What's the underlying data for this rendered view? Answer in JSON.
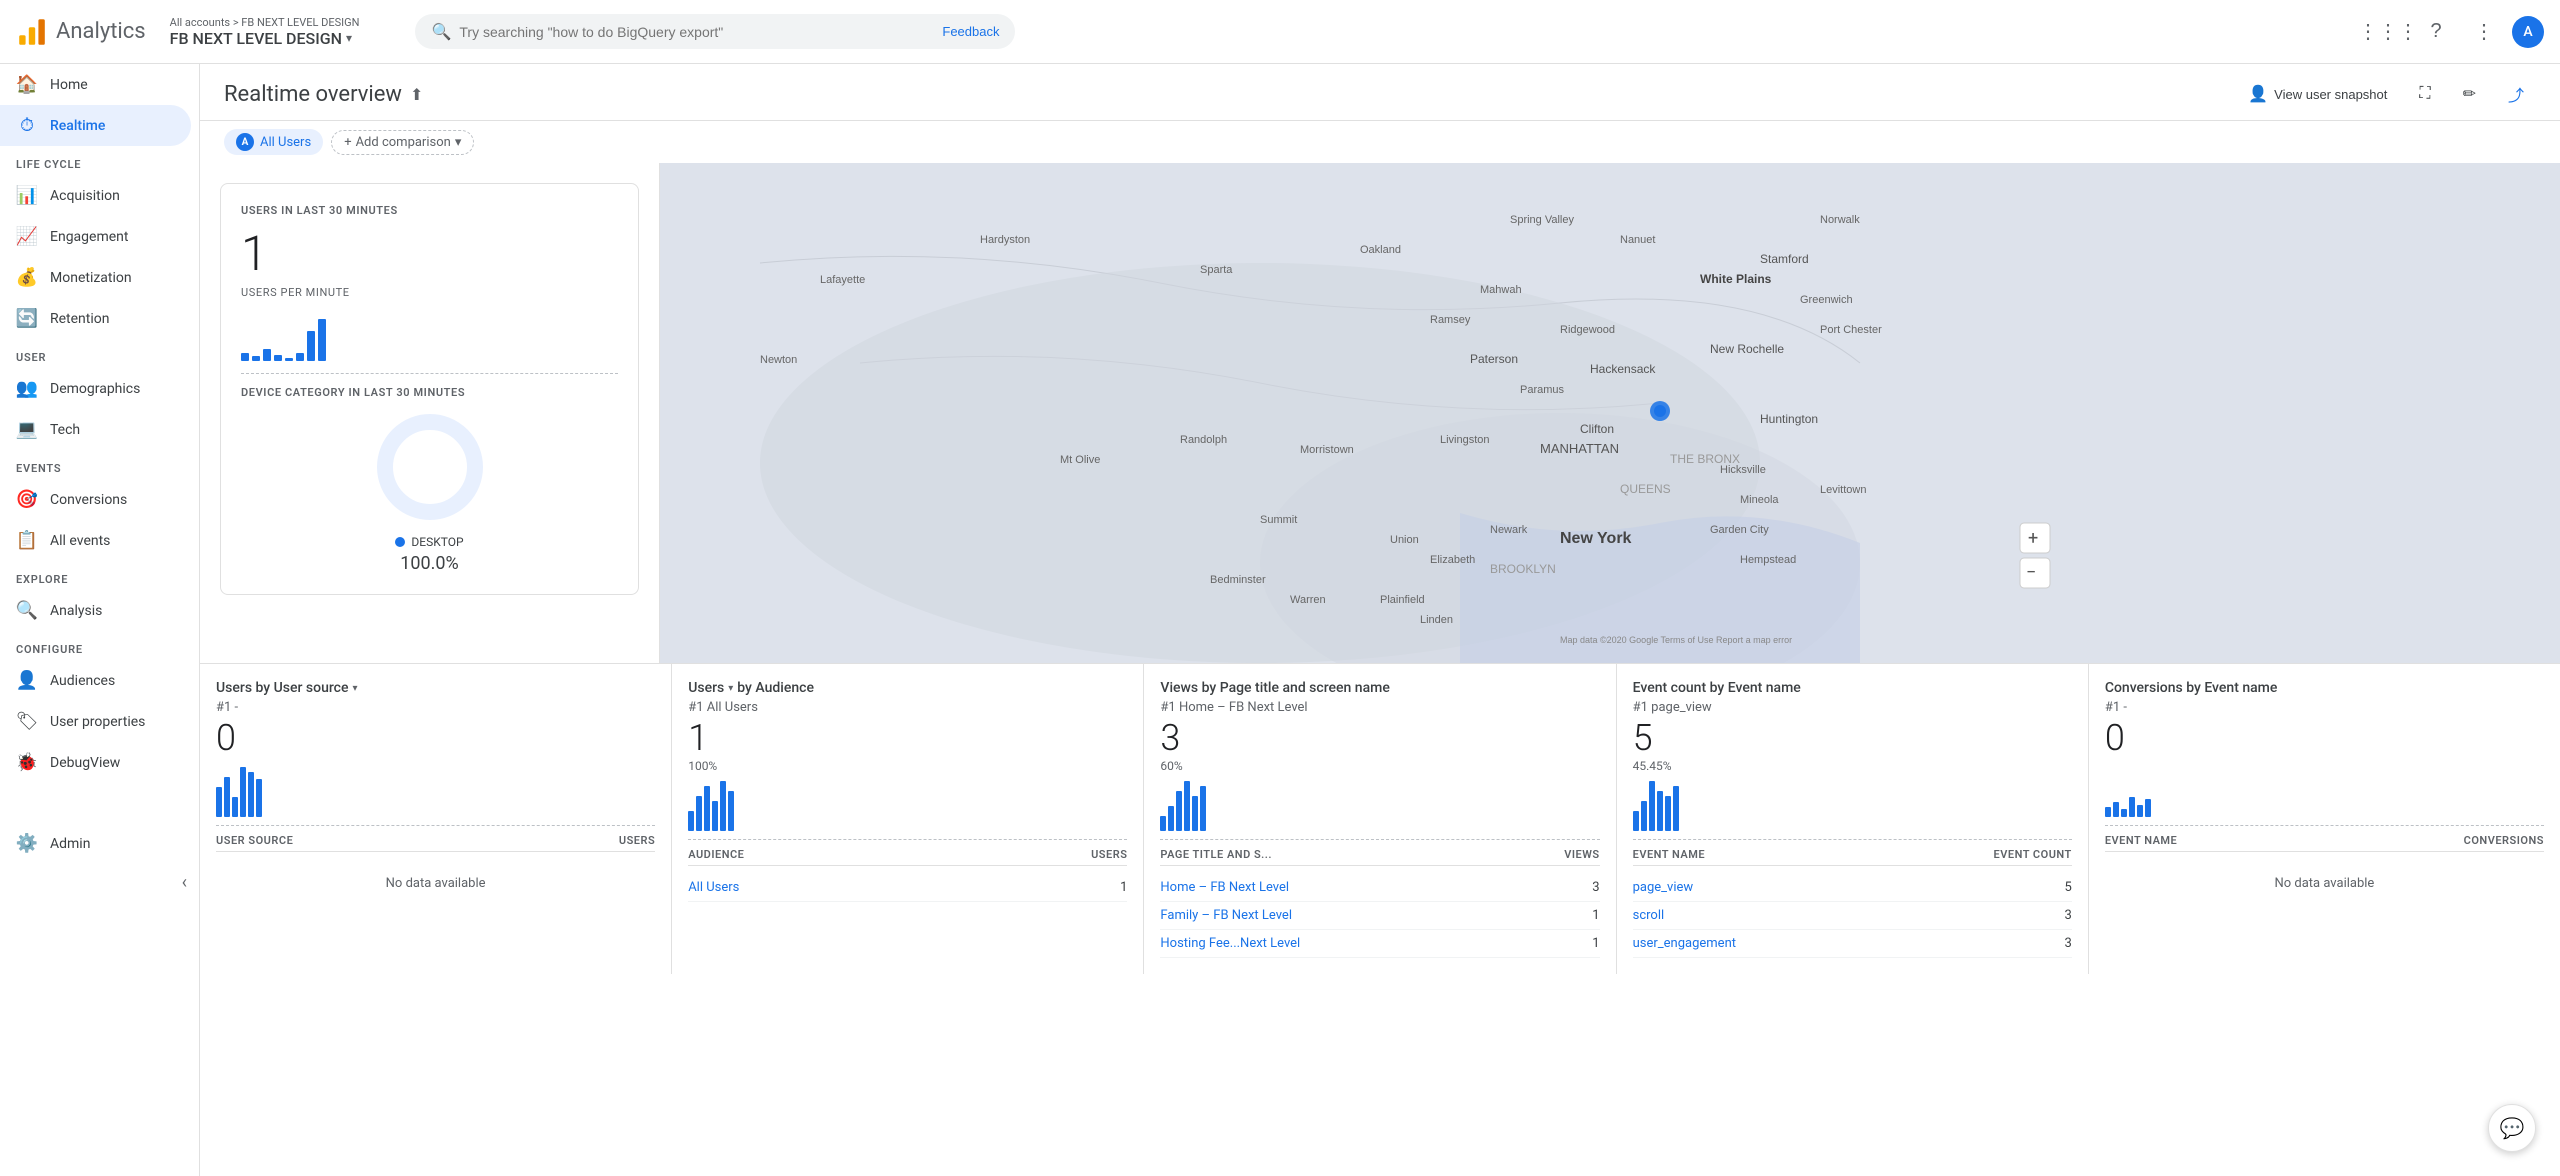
{
  "topbar": {
    "logo_text": "Analytics",
    "breadcrumb_top": "All accounts > FB NEXT LEVEL DESIGN",
    "account_name": "FB NEXT LEVEL DESIGN",
    "search_placeholder": "Try searching \"how to do BigQuery export\"",
    "feedback_label": "Feedback",
    "avatar_letter": "A"
  },
  "sidebar": {
    "items": [
      {
        "id": "home",
        "label": "Home",
        "icon": "🏠"
      },
      {
        "id": "realtime",
        "label": "Realtime",
        "icon": "⏱",
        "active": true
      }
    ],
    "sections": [
      {
        "label": "LIFE CYCLE",
        "items": [
          {
            "id": "acquisition",
            "label": "Acquisition",
            "icon": "📊"
          },
          {
            "id": "engagement",
            "label": "Engagement",
            "icon": "📈"
          },
          {
            "id": "monetization",
            "label": "Monetization",
            "icon": "💰"
          },
          {
            "id": "retention",
            "label": "Retention",
            "icon": "🔄"
          }
        ]
      },
      {
        "label": "USER",
        "items": [
          {
            "id": "demographics",
            "label": "Demographics",
            "icon": "👥"
          },
          {
            "id": "tech",
            "label": "Tech",
            "icon": "💻"
          }
        ]
      },
      {
        "label": "EVENTS",
        "items": [
          {
            "id": "conversions",
            "label": "Conversions",
            "icon": "🎯"
          },
          {
            "id": "all-events",
            "label": "All events",
            "icon": "📋"
          }
        ]
      },
      {
        "label": "EXPLORE",
        "items": [
          {
            "id": "analysis",
            "label": "Analysis",
            "icon": "🔍"
          }
        ]
      },
      {
        "label": "CONFIGURE",
        "items": [
          {
            "id": "audiences",
            "label": "Audiences",
            "icon": "👤"
          },
          {
            "id": "user-properties",
            "label": "User properties",
            "icon": "🏷"
          },
          {
            "id": "debugview",
            "label": "DebugView",
            "icon": "🐞"
          }
        ]
      }
    ],
    "admin_label": "Admin",
    "collapse_label": "‹"
  },
  "realtime": {
    "title": "Realtime overview",
    "view_snapshot_label": "View user snapshot",
    "all_users_label": "All Users",
    "add_comparison_label": "Add comparison",
    "stats": {
      "users_label": "USERS IN LAST 30 MINUTES",
      "users_value": "1",
      "users_per_min_label": "USERS PER MINUTE",
      "device_label": "DEVICE CATEGORY IN LAST 30 MINUTES",
      "device_type": "DESKTOP",
      "device_pct": "100.0%"
    }
  },
  "cards": [
    {
      "id": "user-source",
      "title": "Users by User source",
      "has_dropdown": true,
      "rank": "#1 -",
      "value": "0",
      "col1": "USER SOURCE",
      "col2": "USERS",
      "no_data": "No data available",
      "chart_bars": [
        30,
        40,
        20,
        50,
        45,
        38
      ]
    },
    {
      "id": "audience",
      "title": "Users by Audience",
      "has_dropdown": true,
      "rank": "#1 All Users",
      "value": "1",
      "pct": "100%",
      "col1": "AUDIENCE",
      "col2": "USERS",
      "rows": [
        {
          "label": "All Users",
          "value": "1"
        }
      ],
      "chart_bars": [
        20,
        35,
        45,
        30,
        50,
        40
      ]
    },
    {
      "id": "page-title",
      "title": "Views by Page title and screen name",
      "has_dropdown": false,
      "rank": "#1 Home – FB Next Level",
      "value": "3",
      "pct": "60%",
      "col1": "PAGE TITLE AND S...",
      "col2": "VIEWS",
      "rows": [
        {
          "label": "Home – FB Next Level",
          "value": "3"
        },
        {
          "label": "Family – FB Next Level",
          "value": "1"
        },
        {
          "label": "Hosting Fee...Next Level",
          "value": "1"
        }
      ],
      "chart_bars": [
        15,
        25,
        40,
        50,
        35,
        45
      ]
    },
    {
      "id": "event-count",
      "title": "Event count by Event name",
      "has_dropdown": false,
      "rank": "#1  page_view",
      "value": "5",
      "pct": "45.45%",
      "col1": "EVENT NAME",
      "col2": "EVENT COUNT",
      "rows": [
        {
          "label": "page_view",
          "value": "5"
        },
        {
          "label": "scroll",
          "value": "3"
        },
        {
          "label": "user_engagement",
          "value": "3"
        }
      ],
      "chart_bars": [
        20,
        30,
        50,
        40,
        35,
        45
      ]
    },
    {
      "id": "conversions-event",
      "title": "Conversions by Event name",
      "has_dropdown": false,
      "rank": "#1 -",
      "value": "0",
      "col1": "EVENT NAME",
      "col2": "CONVERSIONS",
      "no_data": "No data available",
      "chart_bars": [
        10,
        15,
        8,
        20,
        12,
        18
      ]
    }
  ],
  "map": {
    "dot_top": "248",
    "dot_left": "880"
  }
}
